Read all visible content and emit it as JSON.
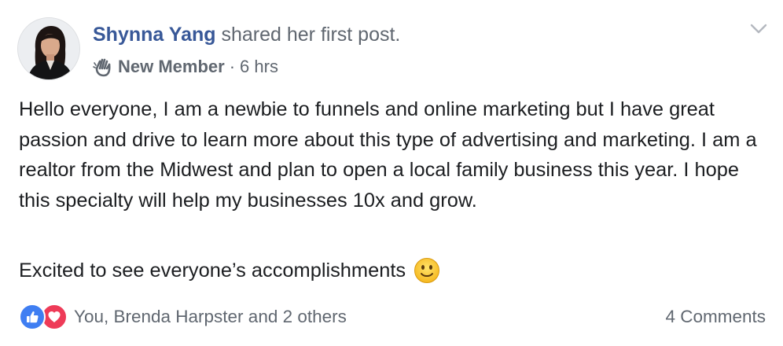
{
  "post": {
    "author_name": "Shynna Yang",
    "shared_text": "shared her first post.",
    "member_badge": "New Member",
    "separator": "·",
    "timestamp": "6 hrs",
    "badge_icon": "waving-hand-icon",
    "paragraph_1": "Hello everyone, I am a newbie to funnels and online marketing but I have great passion and drive to learn more about this type of advertising and marketing. I am a realtor from the Midwest and plan to open a local family business this year. I hope this specialty will help my businesses 10x and grow.",
    "paragraph_2": "Excited to see everyone’s accomplishments",
    "emoji": "slightly-smiling-face-icon"
  },
  "footer": {
    "reaction_icons": [
      "like-icon",
      "love-icon"
    ],
    "reaction_summary": "You, Brenda Harpster and 2 others",
    "comments_label": "4 Comments"
  },
  "colors": {
    "author": "#385898",
    "secondary_text": "#606770",
    "body_text": "#1c1e21",
    "like": "#3f7ef2",
    "love": "#ee3b58"
  }
}
